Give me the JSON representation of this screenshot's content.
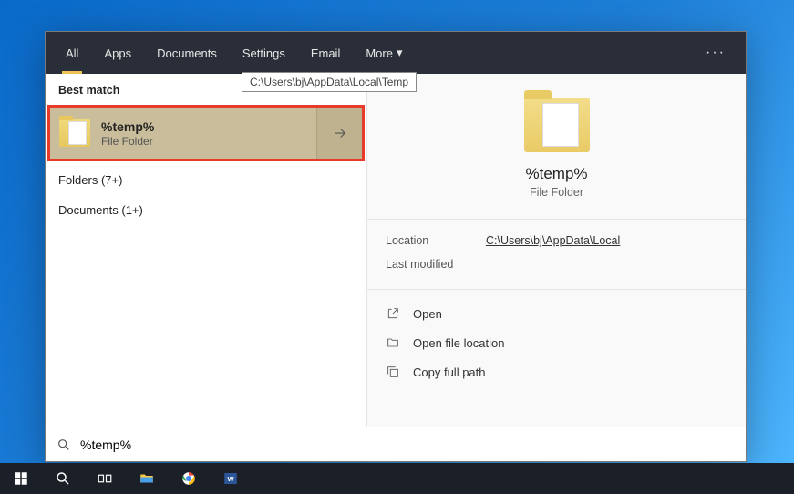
{
  "tabs": {
    "all": "All",
    "apps": "Apps",
    "documents": "Documents",
    "settings": "Settings",
    "email": "Email",
    "more": "More"
  },
  "tooltip": "C:\\Users\\bj\\AppData\\Local\\Temp",
  "left": {
    "best_match": "Best match",
    "result_title": "%temp%",
    "result_sub": "File Folder",
    "groups": {
      "folders": "Folders (7+)",
      "documents": "Documents (1+)"
    }
  },
  "preview": {
    "title": "%temp%",
    "sub": "File Folder",
    "location_label": "Location",
    "location_value": "C:\\Users\\bj\\AppData\\Local",
    "last_modified_label": "Last modified",
    "actions": {
      "open": "Open",
      "open_loc": "Open file location",
      "copy_path": "Copy full path"
    }
  },
  "search_query": "%temp%"
}
